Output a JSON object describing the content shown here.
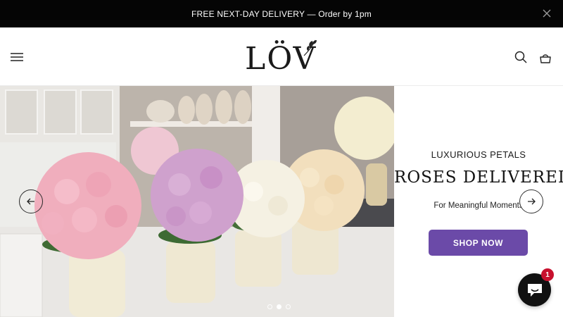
{
  "announcement": {
    "text": "FREE NEXT-DAY DELIVERY — Order by 1pm",
    "close_icon": "close-icon"
  },
  "header": {
    "logo_text": "LÖV",
    "menu_icon": "hamburger-menu-icon",
    "search_icon": "search-icon",
    "cart_icon": "cart-icon"
  },
  "hero": {
    "eyebrow": "LUXURIOUS PETALS",
    "headline": "ROSES DELIVERED",
    "subline": "For Meaningful Moments",
    "cta": "SHOP NOW",
    "slides": 3,
    "active_slide": 2,
    "colors": {
      "cta": "#6b4aa8"
    }
  },
  "chat": {
    "badge": "1",
    "icon": "chat-bubble-icon"
  }
}
